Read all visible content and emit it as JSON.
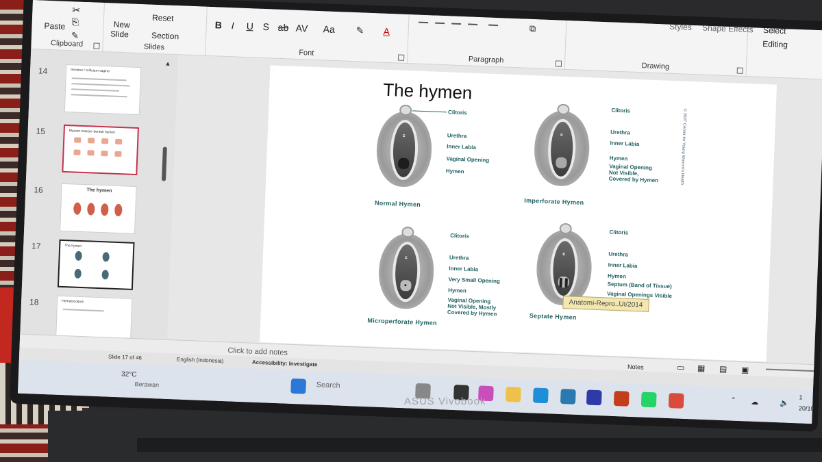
{
  "ribbon": {
    "clipboard": {
      "label": "Clipboard",
      "paste": "Paste"
    },
    "slides": {
      "label": "Slides",
      "new_slide": "New",
      "new_slide2": "Slide",
      "reset": "Reset",
      "section": "Section"
    },
    "font": {
      "label": "Font",
      "bold": "B",
      "italic": "I",
      "underline": "U",
      "shadow": "S",
      "strike": "ab",
      "spacing": "AV",
      "case": "Aa",
      "color": "A"
    },
    "paragraph": {
      "label": "Paragraph"
    },
    "drawing": {
      "label": "Drawing",
      "styles": "Styles",
      "shape_effects": "Shape Effects"
    },
    "editing": {
      "label": "Editing",
      "select": "Select"
    }
  },
  "thumbnails": [
    {
      "num": "14",
      "title": "Introitus / orificium vagina",
      "state": "normal"
    },
    {
      "num": "15",
      "title": "Macam-macam bentuk hymen",
      "state": "selected"
    },
    {
      "num": "16",
      "title": "The hymen",
      "state": "normal"
    },
    {
      "num": "17",
      "title": "The hymen",
      "state": "current"
    },
    {
      "num": "18",
      "title": "Hematocolpos",
      "state": "normal"
    }
  ],
  "slide": {
    "title": "The hymen",
    "credit": "© 2007 Center for Young Women's Health",
    "tooltip": "Anatomi-Repro..Ut/2014",
    "diagrams": {
      "normal": {
        "caption": "Normal Hymen",
        "labels": [
          "Clitoris",
          "Urethra",
          "Inner Labia",
          "Vaginal Opening",
          "Hymen"
        ]
      },
      "imperforate": {
        "caption": "Imperforate Hymen",
        "labels": [
          "Clitoris",
          "Urethra",
          "Inner Labia",
          "Hymen",
          "Vaginal Opening",
          "Not Visible,",
          "Covered by Hymen"
        ]
      },
      "microperforate": {
        "caption": "Microperforate Hymen",
        "labels": [
          "Clitoris",
          "Urethra",
          "Inner Labia",
          "Very Small Opening",
          "Hymen",
          "Vaginal Opening",
          "Not Visible, Mostly",
          "Covered by Hymen"
        ]
      },
      "septate": {
        "caption": "Septate Hymen",
        "labels": [
          "Clitoris",
          "Urethra",
          "Inner Labia",
          "Hymen",
          "Septum (Band of Tissue)",
          "Vaginal Openings Visible"
        ]
      }
    }
  },
  "notes": {
    "placeholder": "Click to add notes",
    "notes_btn": "Notes"
  },
  "status": {
    "slide_count": "Slide 17 of 46",
    "language": "English (Indonesia)",
    "accessibility": "Accessibility: Investigate"
  },
  "taskbar": {
    "search": "Search",
    "weather_temp": "32°C",
    "weather_text": "Berawan",
    "date": "20/10/",
    "time": "1"
  },
  "device": {
    "brand": "ASUS Vivobook"
  },
  "colors": {
    "label_teal": "#1f5f5f",
    "tooltip_bg": "#f3e7b0",
    "selected_border": "#c4314b"
  }
}
